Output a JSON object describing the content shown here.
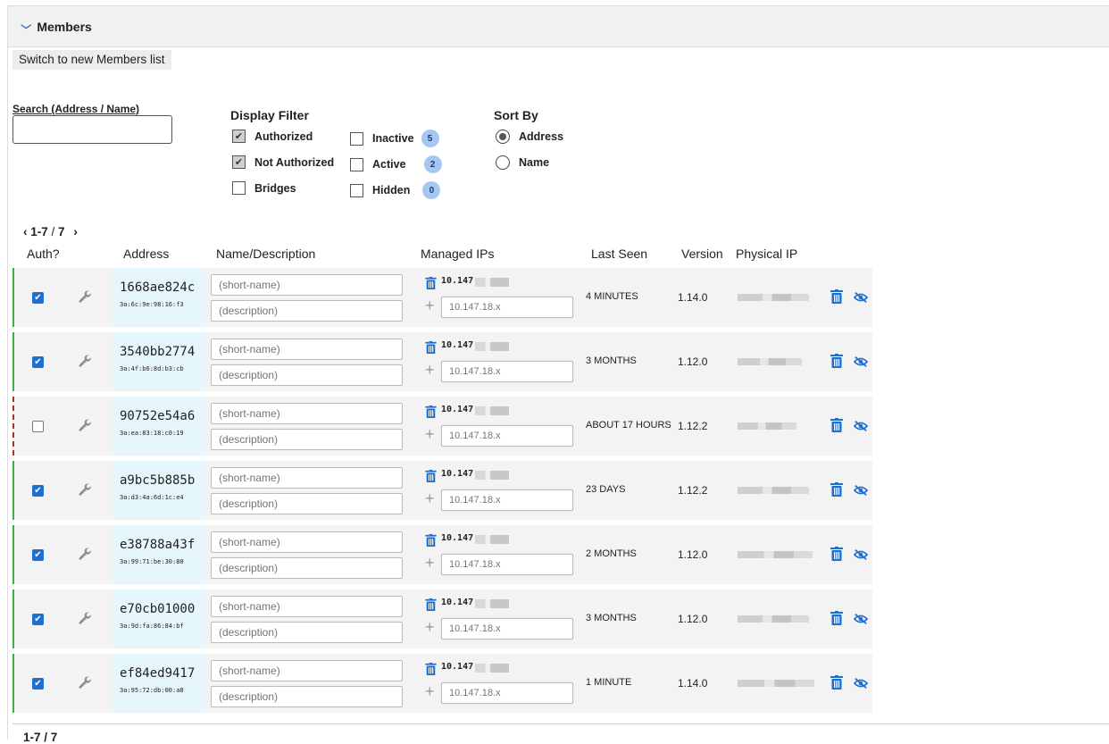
{
  "panel": {
    "title": "Members"
  },
  "switch_label": "Switch to new Members list",
  "search": {
    "label": "Search (Address / Name)",
    "value": ""
  },
  "display_filter": {
    "title": "Display Filter",
    "authorized": "Authorized",
    "not_authorized": "Not Authorized",
    "bridges": "Bridges",
    "inactive": "Inactive",
    "inactive_count": "5",
    "active": "Active",
    "active_count": "2",
    "hidden": "Hidden",
    "hidden_count": "0"
  },
  "sort_by": {
    "title": "Sort By",
    "address": "Address",
    "name": "Name",
    "selected": "Address"
  },
  "pager": {
    "range": "1-7",
    "sep": " / ",
    "total": "7",
    "bottom_text": "1-7 / 7"
  },
  "columns": {
    "auth": "Auth?",
    "address": "Address",
    "name": "Name/Description",
    "ips": "Managed IPs",
    "last_seen": "Last Seen",
    "version": "Version",
    "physical_ip": "Physical IP"
  },
  "placeholders": {
    "name": "(short-name)",
    "description": "(description)",
    "ip": "10.147.18.x"
  },
  "ip_prefix": "10.147",
  "colors": {
    "accent": "#1f6fd1",
    "authorized_bar": "#3cb043",
    "unauthorized_bar": "#b03030",
    "badge": "#a5c8f3"
  },
  "icons": [
    "chevron-down-icon",
    "chevron-left-icon",
    "chevron-right-icon",
    "wrench-icon",
    "trash-icon",
    "plus-icon",
    "eye-off-icon"
  ],
  "members": [
    {
      "address": "1668ae824c",
      "mac": "3a:6c:9e:98:16:f3",
      "authorized": true,
      "last_seen": "4 MINUTES",
      "version": "1.14.0"
    },
    {
      "address": "3540bb2774",
      "mac": "3a:4f:b6:8d:b3:cb",
      "authorized": true,
      "last_seen": "3 MONTHS",
      "version": "1.12.0"
    },
    {
      "address": "90752e54a6",
      "mac": "3a:ea:83:18:c0:19",
      "authorized": false,
      "last_seen": "ABOUT 17 HOURS",
      "version": "1.12.2"
    },
    {
      "address": "a9bc5b885b",
      "mac": "3a:d3:4a:6d:1c:e4",
      "authorized": true,
      "last_seen": "23 DAYS",
      "version": "1.12.2"
    },
    {
      "address": "e38788a43f",
      "mac": "3a:99:71:be:30:80",
      "authorized": true,
      "last_seen": "2 MONTHS",
      "version": "1.12.0"
    },
    {
      "address": "e70cb01000",
      "mac": "3a:9d:fa:86:84:bf",
      "authorized": true,
      "last_seen": "3 MONTHS",
      "version": "1.12.0"
    },
    {
      "address": "ef84ed9417",
      "mac": "3a:95:72:db:00:a8",
      "authorized": true,
      "last_seen": "1 MINUTE",
      "version": "1.14.0"
    }
  ]
}
